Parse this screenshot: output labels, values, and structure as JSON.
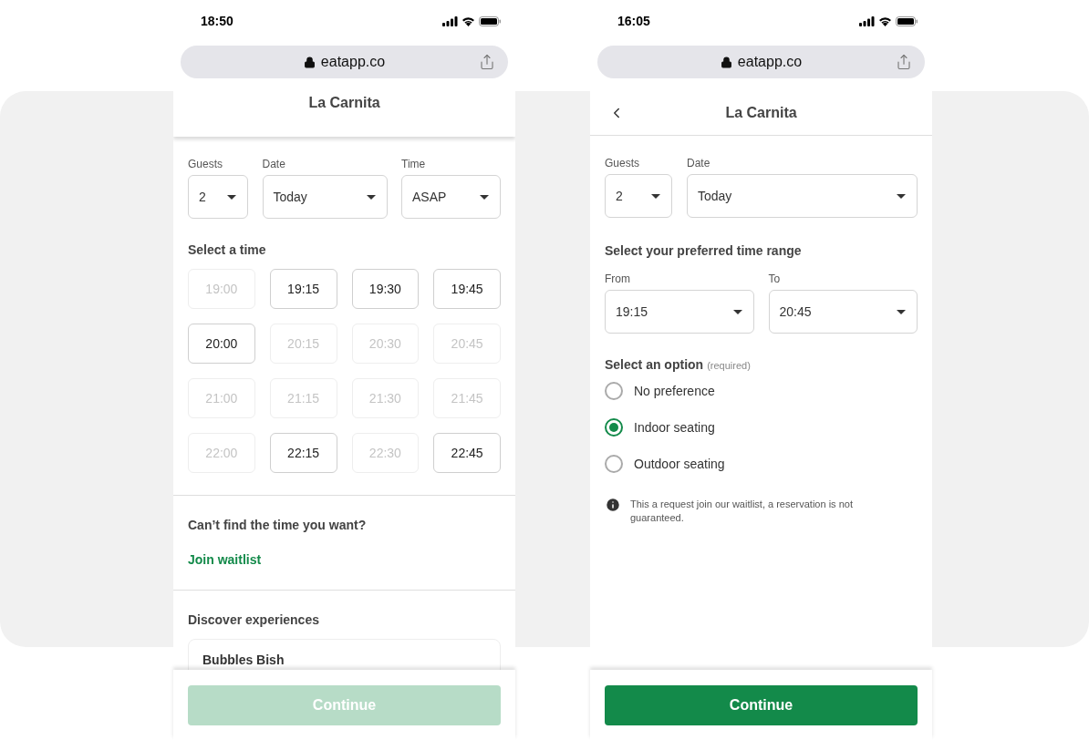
{
  "screens": [
    {
      "kind": "time_grid",
      "status_time": "18:50",
      "url": "eatapp.co",
      "title": "La Carnita",
      "back_button": false,
      "selectors": [
        {
          "label": "Guests",
          "value": "2"
        },
        {
          "label": "Date",
          "value": "Today"
        },
        {
          "label": "Time",
          "value": "ASAP"
        }
      ],
      "section_title": "Select a time",
      "slots": [
        {
          "time": "19:00",
          "disabled": true
        },
        {
          "time": "19:15",
          "disabled": false
        },
        {
          "time": "19:30",
          "disabled": false
        },
        {
          "time": "19:45",
          "disabled": false
        },
        {
          "time": "20:00",
          "disabled": false
        },
        {
          "time": "20:15",
          "disabled": true
        },
        {
          "time": "20:30",
          "disabled": true
        },
        {
          "time": "20:45",
          "disabled": true
        },
        {
          "time": "21:00",
          "disabled": true
        },
        {
          "time": "21:15",
          "disabled": true
        },
        {
          "time": "21:30",
          "disabled": true
        },
        {
          "time": "21:45",
          "disabled": true
        },
        {
          "time": "22:00",
          "disabled": true
        },
        {
          "time": "22:15",
          "disabled": false
        },
        {
          "time": "22:30",
          "disabled": true
        },
        {
          "time": "22:45",
          "disabled": false
        }
      ],
      "waitlist": {
        "question": "Can’t find the time you want?",
        "link": "Join waitlist"
      },
      "experiences": {
        "title": "Discover experiences",
        "items": [
          "Bubbles Bish"
        ]
      },
      "continue": {
        "label": "Continue",
        "disabled": true
      }
    },
    {
      "kind": "time_range",
      "status_time": "16:05",
      "url": "eatapp.co",
      "title": "La Carnita",
      "back_button": true,
      "selectors": [
        {
          "label": "Guests",
          "value": "2"
        },
        {
          "label": "Date",
          "value": "Today"
        }
      ],
      "section_title": "Select your preferred time range",
      "range": [
        {
          "label": "From",
          "value": "19:15"
        },
        {
          "label": "To",
          "value": "20:45"
        }
      ],
      "options_title": "Select an option",
      "options_hint": "(required)",
      "options": [
        {
          "label": "No preference",
          "selected": false
        },
        {
          "label": "Indoor seating",
          "selected": true
        },
        {
          "label": "Outdoor seating",
          "selected": false
        }
      ],
      "notice": "This a request join our waitlist, a reservation is not guaranteed.",
      "continue": {
        "label": "Continue",
        "disabled": false
      }
    }
  ]
}
